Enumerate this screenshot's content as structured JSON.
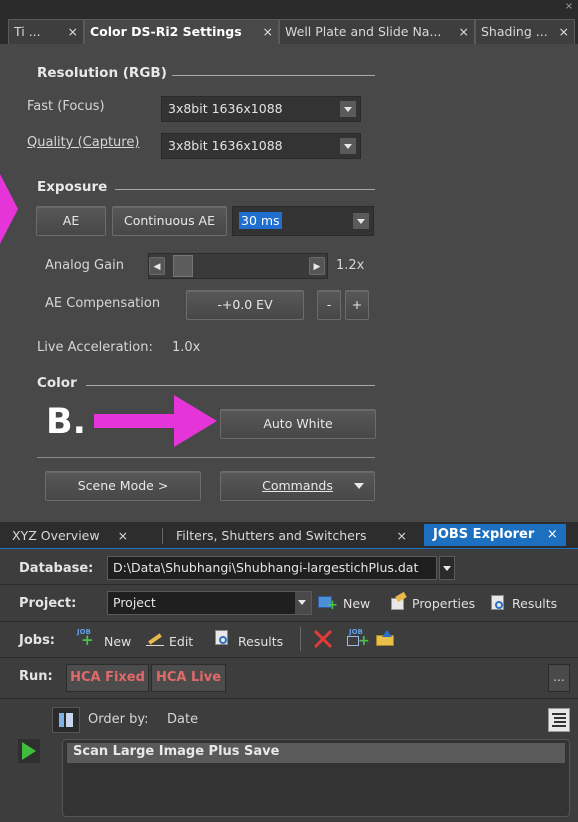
{
  "top_tabs": [
    {
      "label": "Ti ...",
      "close": "×"
    },
    {
      "label": "Color DS-Ri2 Settings",
      "close": "×"
    },
    {
      "label": "Well Plate and Slide Na...",
      "close": "×"
    },
    {
      "label": "Shading ...",
      "close": "×"
    }
  ],
  "window_close": "×",
  "resolution": {
    "title": "Resolution (RGB)",
    "fast_label": "Fast (Focus)",
    "fast_value": "3x8bit 1636x1088",
    "quality_label": "Quality (Capture)",
    "quality_value": "3x8bit 1636x1088"
  },
  "exposure": {
    "title": "Exposure",
    "ae_button": "AE",
    "continuous_ae_button": "Continuous AE",
    "exposure_value": "30 ms",
    "analog_gain_label": "Analog Gain",
    "analog_gain_value": "1.2x",
    "analog_gain_slider_level": 0.0,
    "ae_comp_label": "AE Compensation",
    "ae_comp_value": "-+0.0 EV",
    "minus": "-",
    "plus": "+",
    "live_accel_label": "Live Acceleration:",
    "live_accel_value": "1.0x"
  },
  "color": {
    "title": "Color",
    "auto_white_button": "Auto White",
    "annotation_label": "B."
  },
  "scene_mode_button": "Scene Mode >",
  "commands_button": "Commands",
  "bottom_tabs": [
    {
      "label": "XYZ Overview",
      "close": "×"
    },
    {
      "label": "Filters, Shutters and Switchers",
      "close": "×"
    },
    {
      "label": "JOBS Explorer",
      "close": "×"
    }
  ],
  "jobs": {
    "database_label": "Database:",
    "database_value": "D:\\Data\\Shubhangi\\Shubhangi-largestichPlus.dat",
    "project_label": "Project:",
    "project_value": "Project",
    "project_new": "New",
    "project_properties": "Properties",
    "project_results": "Results",
    "jobs_label": "Jobs:",
    "jobs_new": "New",
    "jobs_edit": "Edit",
    "jobs_results": "Results",
    "run_label": "Run:",
    "hca_fixed": "HCA Fixed",
    "hca_live": "HCA Live",
    "more": "...",
    "order_by_label": "Order by:",
    "order_by_value": "Date",
    "job_items": [
      "Scan Large Image Plus Save"
    ]
  },
  "colors": {
    "accent_blue": "#1d6fc0",
    "annotation_magenta": "#e534d7",
    "hca_red": "#e06a6a"
  }
}
